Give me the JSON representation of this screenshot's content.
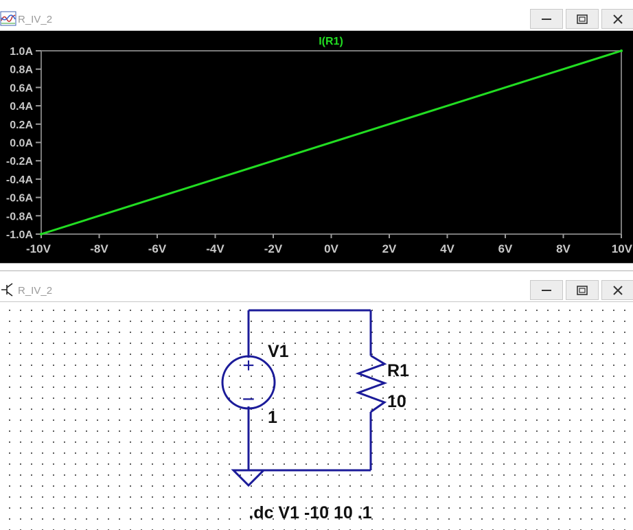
{
  "waveform_window": {
    "title": "R_IV_2",
    "icon": "waveform-viewer-icon",
    "trace_label": "I(R1)",
    "trace_color": "#22dd22"
  },
  "schematic_window": {
    "title": "R_IV_2",
    "icon": "schematic-transistor-icon",
    "wire_color": "#1b1b99"
  },
  "window_buttons": {
    "minimize": "minimize-icon",
    "maximize": "maximize-icon",
    "close": "close-icon"
  },
  "chart_data": {
    "type": "line",
    "title": "I(R1)",
    "xlabel": "",
    "ylabel": "",
    "x_ticks": [
      "-10V",
      "-8V",
      "-6V",
      "-4V",
      "-2V",
      "0V",
      "2V",
      "4V",
      "6V",
      "8V",
      "10V"
    ],
    "y_ticks": [
      "1.0A",
      "0.8A",
      "0.6A",
      "0.4A",
      "0.2A",
      "0.0A",
      "-0.2A",
      "-0.4A",
      "-0.6A",
      "-0.8A",
      "-1.0A"
    ],
    "xlim": [
      -10,
      10
    ],
    "ylim": [
      -1.0,
      1.0
    ],
    "grid": false,
    "series": [
      {
        "name": "I(R1)",
        "color": "#22dd22",
        "x": [
          -10,
          10
        ],
        "y": [
          -1.0,
          1.0
        ]
      }
    ]
  },
  "components": {
    "v1_name": "V1",
    "v1_value": "1",
    "v1_plus": "+",
    "v1_minus": "−",
    "r1_name": "R1",
    "r1_value": "10",
    "directive": ".dc V1 -10 10 .1"
  }
}
